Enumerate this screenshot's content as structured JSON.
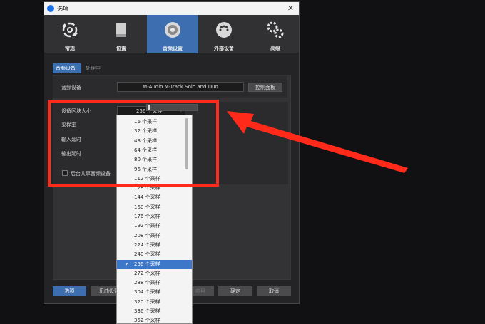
{
  "window": {
    "title": "选项",
    "close_glyph": "✕"
  },
  "toolbar": [
    {
      "label": "常规",
      "icon": "gear-arrows-icon"
    },
    {
      "label": "位置",
      "icon": "drive-icon"
    },
    {
      "label": "音频设置",
      "icon": "speaker-icon",
      "active": true
    },
    {
      "label": "外部设备",
      "icon": "midi-connector-icon"
    },
    {
      "label": "高级",
      "icon": "gears-icon"
    }
  ],
  "tabs": [
    {
      "label": "音频设备",
      "active": true
    },
    {
      "label": "处理中",
      "active": false
    }
  ],
  "device": {
    "label": "音频设备",
    "value": "M-Audio M-Track Solo and Duo",
    "control_panel": "控制面板"
  },
  "settings": {
    "block_size_label": "设备区块大小",
    "block_size_value": "256 个采样",
    "sample_rate_label": "采样率",
    "input_latency_label": "输入延时",
    "output_latency_label": "输出延时",
    "background_share_label": "后台共享音频设备"
  },
  "dropdown_options": [
    "16 个采样",
    "32 个采样",
    "48 个采样",
    "64 个采样",
    "80 个采样",
    "96 个采样",
    "112 个采样",
    "128 个采样",
    "144 个采样",
    "160 个采样",
    "176 个采样",
    "192 个采样",
    "208 个采样",
    "224 个采样",
    "240 个采样",
    "256 个采样",
    "272 个采样",
    "288 个采样",
    "304 个采样",
    "320 个采样",
    "336 个采样",
    "352 个采样"
  ],
  "selected_option": "256 个采样",
  "bottom": {
    "options": "选项",
    "song_settings": "乐曲设置",
    "apply": "应用",
    "ok": "确定",
    "cancel": "取消"
  },
  "colors": {
    "accent": "#3d6fb0",
    "annotation": "#ff2a1a"
  }
}
